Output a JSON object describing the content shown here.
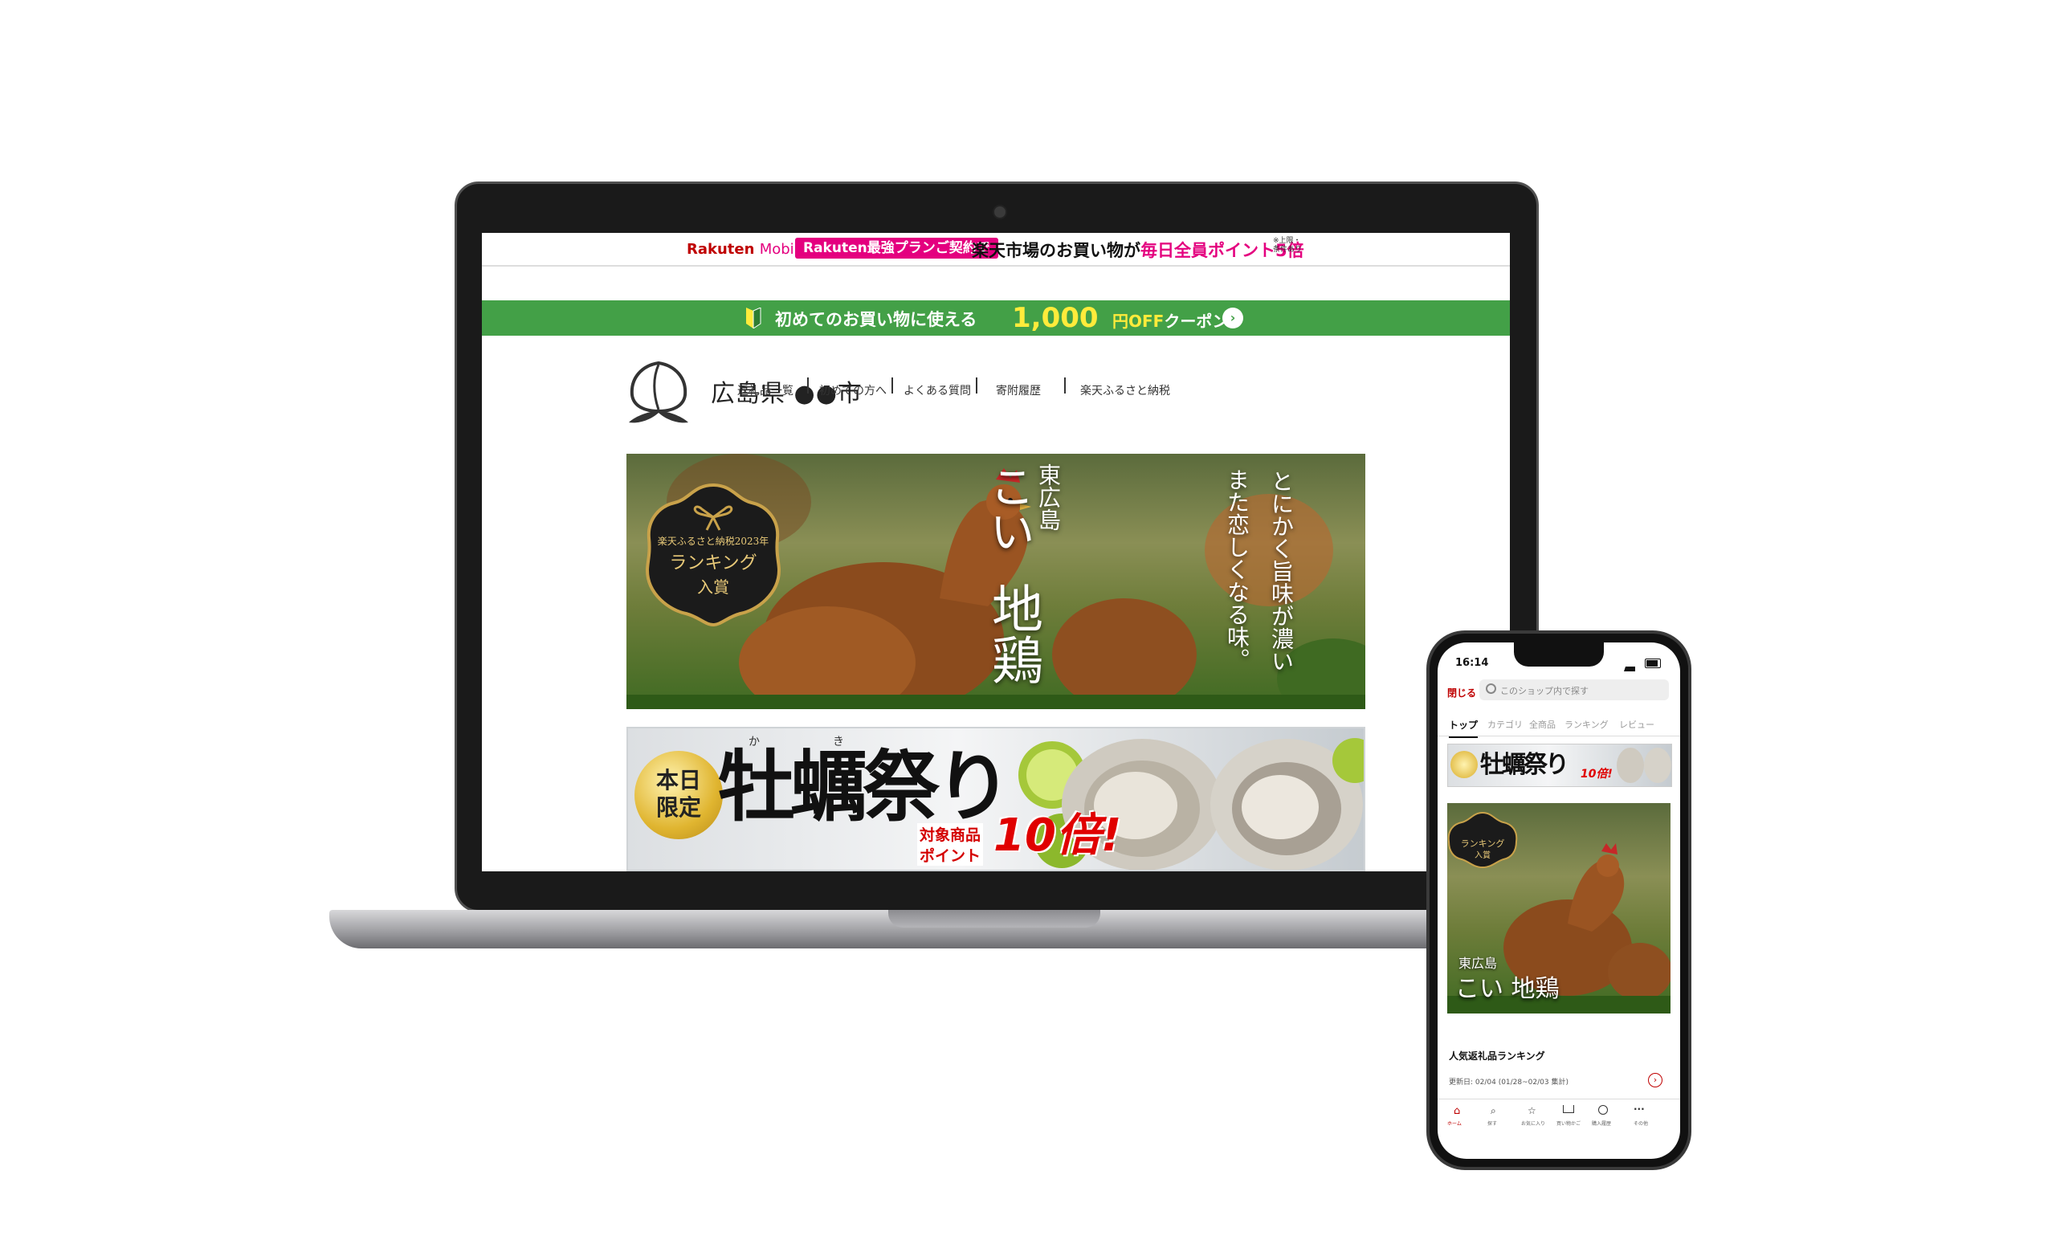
{
  "site": {
    "promo": {
      "brand": "Rakuten",
      "brand_sub": "Mobile",
      "pill": "Rakuten最強プランご契約で",
      "text_a": "楽天市場のお買い物が",
      "text_b": "毎日全員ポイント5倍",
      "note": "※上限・条件あり"
    },
    "coupon": {
      "text": "初めてのお買い物に使える",
      "amount": "1,000",
      "unit": "円OFF",
      "label": "クーポン"
    },
    "shop": {
      "name": "広島県 ●●市"
    },
    "nav": [
      "返礼品一覧",
      "初めての方へ",
      "よくある質問",
      "寄附履歴",
      "楽天ふるさと納税"
    ],
    "chicken_banner": {
      "badge_line1": "楽天ふるさと納税2023年",
      "badge_line2": "ランキング",
      "badge_line3": "入賞",
      "region": "東広島",
      "title_a": "こい",
      "title_b": "地鶏",
      "tagline_a": "とにかく旨味が濃い",
      "tagline_b": "また恋しくなる味。"
    },
    "oyster_banner": {
      "badge": "本日限定",
      "ruby_ka": "か",
      "ruby_ki": "き",
      "title": "牡蠣祭り",
      "label_a": "対象商品",
      "label_b": "ポイント",
      "points": "10倍!"
    }
  },
  "phone": {
    "time": "16:14",
    "close": "閉じる",
    "search_placeholder": "このショップ内で探す",
    "tabs": [
      "トップ",
      "カテゴリ",
      "全商品",
      "ランキング",
      "レビュー"
    ],
    "ranking_title": "人気返礼品ランキング",
    "updated": "更新日: 02/04 (01/28~02/03 集計)",
    "bottom_nav": [
      "ホーム",
      "探す",
      "お気に入り",
      "買い物かご",
      "購入履歴",
      "その他"
    ]
  },
  "colors": {
    "rakuten_red": "#bf0000",
    "magenta": "#e4007f",
    "coupon_green": "#43a047"
  }
}
